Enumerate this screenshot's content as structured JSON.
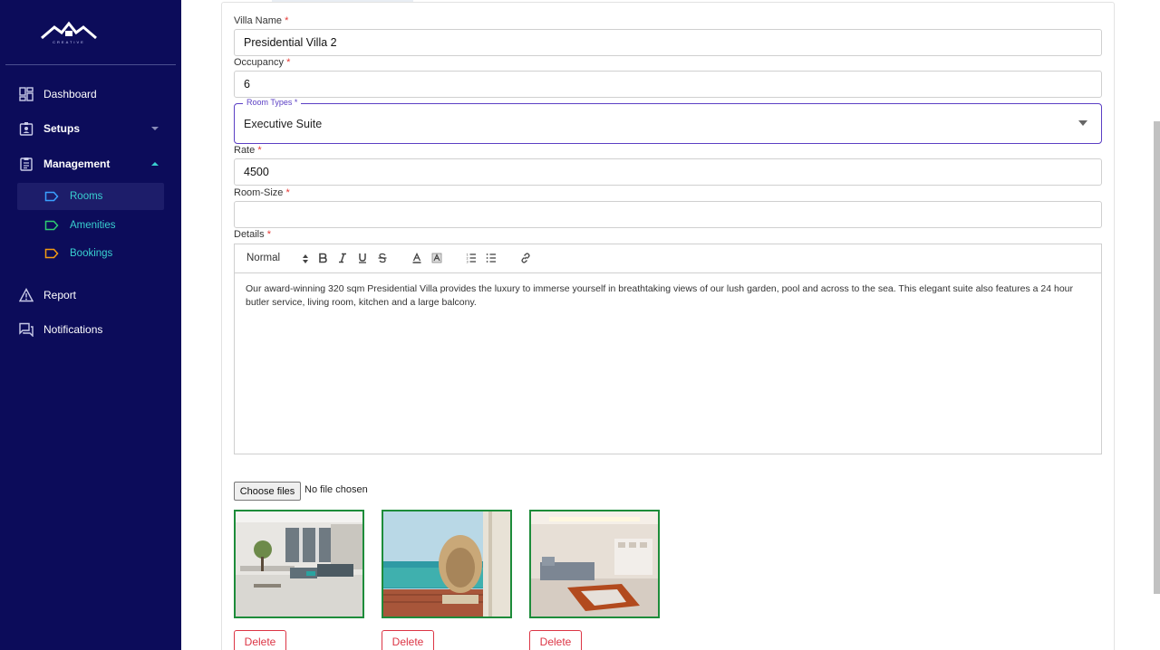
{
  "brand": {
    "logo_text": "CREATIVE"
  },
  "sidebar": {
    "items": [
      {
        "label": "Dashboard",
        "icon": "dashboard-icon"
      },
      {
        "label": "Setups",
        "icon": "badge-icon"
      },
      {
        "label": "Management",
        "icon": "clipboard-icon"
      },
      {
        "label": "Report",
        "icon": "warning-icon"
      },
      {
        "label": "Notifications",
        "icon": "forum-icon"
      }
    ],
    "sub_items": [
      {
        "label": "Rooms",
        "icon": "label-icon",
        "color": "#3aa0ff"
      },
      {
        "label": "Amenities",
        "icon": "label-icon",
        "color": "#2ecc71"
      },
      {
        "label": "Bookings",
        "icon": "label-icon",
        "color": "#f39c12"
      }
    ]
  },
  "form": {
    "villa_name": {
      "label": "Villa Name",
      "value": "Presidential Villa 2"
    },
    "occupancy": {
      "label": "Occupancy",
      "value": "6"
    },
    "room_types": {
      "label": "Room Types *",
      "value": "Executive Suite"
    },
    "rate": {
      "label": "Rate",
      "value": "4500"
    },
    "room_size": {
      "label": "Room-Size",
      "value": ""
    },
    "details": {
      "label": "Details",
      "header_select": "Normal",
      "text": "Our award-winning 320 sqm Presidential Villa provides the luxury to immerse yourself in breathtaking views of our lush garden, pool and across to the sea. This elegant suite also features a 24 hour butler service, living room, kitchen and a large balcony."
    },
    "required_mark": "*"
  },
  "upload": {
    "button_label": "Choose files",
    "status": "No file chosen"
  },
  "images": [
    {
      "delete_label": "Delete"
    },
    {
      "delete_label": "Delete"
    },
    {
      "delete_label": "Delete"
    }
  ],
  "colors": {
    "sidebar_bg": "#0c0c5a",
    "accent_purple": "#5b3fc4",
    "delete_red": "#dc3545",
    "thumb_border": "#1d8c3a"
  }
}
